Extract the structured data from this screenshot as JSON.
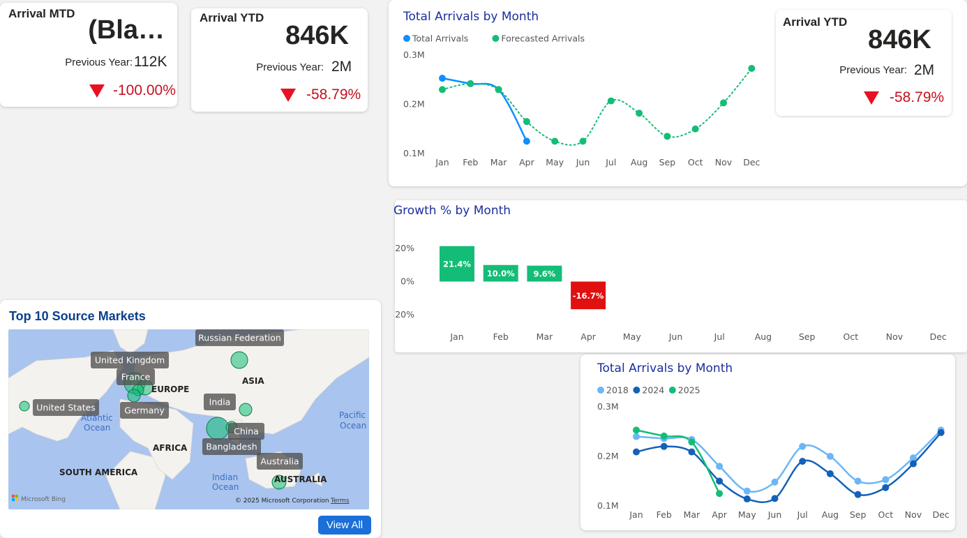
{
  "kpi_mtd": {
    "title": "Arrival MTD",
    "value": "(Bla…",
    "prev_label": "Previous Year:",
    "prev_value": "112K",
    "change": "-100.00%"
  },
  "kpi_ytd_1": {
    "title": "Arrival YTD",
    "value": "846K",
    "prev_label": "Previous Year:",
    "prev_value": "2M",
    "change": "-58.79%"
  },
  "kpi_ytd_2": {
    "title": "Arrival YTD",
    "value": "846K",
    "prev_label": "Previous Year:",
    "prev_value": "2M",
    "change": "-58.79%"
  },
  "map": {
    "title": "Top 10 Source Markets",
    "view_all": "View All",
    "labels": [
      "Russian Federation",
      "United Kingdom",
      "France",
      "United States",
      "Germany",
      "India",
      "China",
      "Bangladesh",
      "Australia"
    ],
    "geo": [
      "ASIA",
      "EUROPE",
      "AFRICA",
      "SOUTH AMERICA",
      "AUSTRALIA",
      "Atlantic",
      "Ocean",
      "Pacific",
      "Ocean",
      "Indian",
      "Ocean"
    ],
    "credit": "© 2025 Microsoft Corporation",
    "terms": "Terms",
    "bing": "Microsoft Bing"
  },
  "colors": {
    "blue": "#118dff",
    "green": "#14bd77",
    "red": "#e01010",
    "light_blue": "#6cb6f5",
    "dark_blue": "#1361b9",
    "title": "#1a2e9e"
  },
  "chart_data": [
    {
      "type": "line",
      "title": "Total Arrivals by Month",
      "categories": [
        "Jan",
        "Feb",
        "Mar",
        "Apr",
        "May",
        "Jun",
        "Jul",
        "Aug",
        "Sep",
        "Oct",
        "Nov",
        "Dec"
      ],
      "yticks": [
        "0.3M",
        "0.2M",
        "0.1M"
      ],
      "ylim": [
        0.1,
        0.3
      ],
      "series": [
        {
          "name": "Total Arrivals",
          "values": [
            0.253,
            0.242,
            0.23,
            0.125,
            null,
            null,
            null,
            null,
            null,
            null,
            null,
            null
          ]
        },
        {
          "name": "Forecasted Arrivals",
          "values": [
            0.23,
            0.242,
            0.23,
            0.165,
            0.125,
            0.125,
            0.207,
            0.182,
            0.135,
            0.15,
            0.203,
            0.273
          ]
        }
      ]
    },
    {
      "type": "bar",
      "title": "Growth % by Month",
      "categories": [
        "Jan",
        "Feb",
        "Mar",
        "Apr",
        "May",
        "Jun",
        "Jul",
        "Aug",
        "Sep",
        "Oct",
        "Nov",
        "Dec"
      ],
      "yticks": [
        "20%",
        "0%",
        "-20%"
      ],
      "ylim": [
        -20,
        20
      ],
      "values": [
        21.4,
        10.0,
        9.6,
        -16.7,
        null,
        null,
        null,
        null,
        null,
        null,
        null,
        null
      ],
      "labels": [
        "21.4%",
        "10.0%",
        "9.6%",
        "-16.7%"
      ]
    },
    {
      "type": "line",
      "title": "Total Arrivals by Month",
      "categories": [
        "Jan",
        "Feb",
        "Mar",
        "Apr",
        "May",
        "Jun",
        "Jul",
        "Aug",
        "Sep",
        "Oct",
        "Nov",
        "Dec"
      ],
      "yticks": [
        "0.3M",
        "0.2M",
        "0.1M"
      ],
      "ylim": [
        0.1,
        0.3
      ],
      "series": [
        {
          "name": "2018",
          "values": [
            0.24,
            0.236,
            0.234,
            0.18,
            0.13,
            0.148,
            0.22,
            0.2,
            0.15,
            0.153,
            0.197,
            0.253
          ]
        },
        {
          "name": "2024",
          "values": [
            0.209,
            0.22,
            0.209,
            0.15,
            0.114,
            0.115,
            0.19,
            0.165,
            0.123,
            0.137,
            0.185,
            0.248
          ]
        },
        {
          "name": "2025",
          "values": [
            0.253,
            0.241,
            0.229,
            0.125,
            null,
            null,
            null,
            null,
            null,
            null,
            null,
            null
          ]
        }
      ]
    }
  ]
}
